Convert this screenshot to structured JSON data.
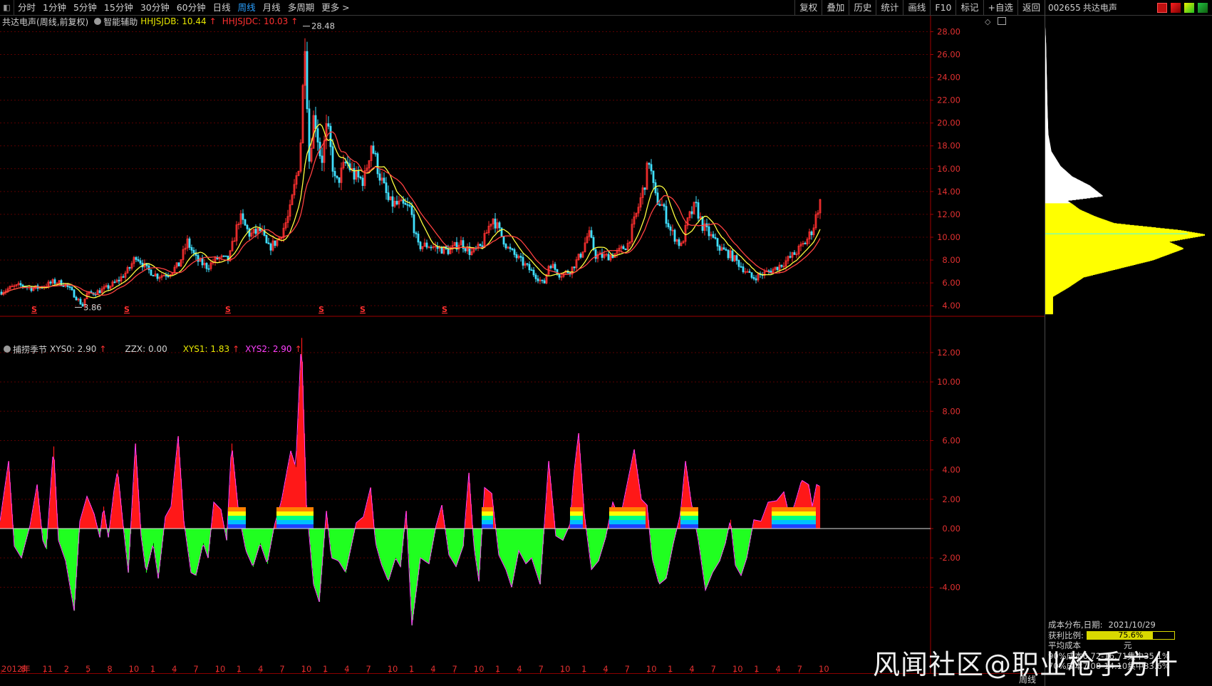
{
  "toolbar": {
    "period_tabs": [
      "分时",
      "1分钟",
      "5分钟",
      "15分钟",
      "30分钟",
      "60分钟",
      "日线",
      "周线",
      "月线",
      "多周期",
      "更多 >"
    ],
    "active_tab_index": 7,
    "right_buttons": [
      "复权",
      "叠加",
      "历史",
      "统计",
      "画线",
      "F10",
      "标记",
      "+自选",
      "返回"
    ]
  },
  "right_panel": {
    "code": "002655",
    "name": "共达电声",
    "cost_title": "成本分布,日期:",
    "cost_date": "2021/10/29",
    "profit_label": "获利比例:",
    "profit_pct": "75.6%",
    "profit_value": 75.6,
    "avg_cost_label": "平均成本",
    "avg_cost_unit": "元",
    "row90": "90%成本6.72-16.71集中35.1%",
    "row70": "70%成本7.08-14.10集中33.6%"
  },
  "price_panel": {
    "stock": "共达电声",
    "period_info": "(周线,前复权)",
    "assist_label": "智能辅助",
    "hh1_label": "HHJSJDB: 10.44",
    "hh2_label": "HHJSJDC: 10.03",
    "high_label": "28.48",
    "low_label": "3.86",
    "s_marker": "S"
  },
  "indicator_panel": {
    "name": "捕捞季节",
    "xys0": "XYS0: 2.90",
    "zzx": "ZZX: 0.00",
    "xys1": "XYS1: 1.83",
    "xys2": "XYS2: 2.90"
  },
  "x_axis": {
    "labels": [
      "2012年",
      "8",
      "11",
      "2",
      "5",
      "8",
      "10",
      "1",
      "4",
      "7",
      "10",
      "1",
      "4",
      "7",
      "10",
      "1",
      "4",
      "7",
      "10",
      "1",
      "4",
      "7",
      "10",
      "1",
      "4",
      "7",
      "10",
      "1",
      "4",
      "7",
      "10",
      "1",
      "4",
      "7",
      "10",
      "1",
      "4",
      "7",
      "10"
    ],
    "period": "周线"
  },
  "watermark": "风闻社区@职业枪手方什",
  "chart_data": [
    {
      "type": "candlestick",
      "title": "共达电声",
      "ylim": [
        3.2,
        29.4
      ],
      "yticks": [
        4,
        6,
        8,
        10,
        12,
        14,
        16,
        18,
        20,
        22,
        24,
        26,
        28
      ],
      "keypoints": [
        [
          0,
          5.2
        ],
        [
          15,
          5.6
        ],
        [
          30,
          5.8
        ],
        [
          45,
          5.5
        ],
        [
          60,
          5.7
        ],
        [
          75,
          6.1
        ],
        [
          90,
          5.9
        ],
        [
          100,
          5.2
        ],
        [
          110,
          4.4
        ],
        [
          115,
          4.0
        ],
        [
          120,
          5.0
        ],
        [
          135,
          5.2
        ],
        [
          150,
          5.6
        ],
        [
          165,
          6.2
        ],
        [
          180,
          7.2
        ],
        [
          190,
          8.4
        ],
        [
          205,
          7.2
        ],
        [
          220,
          6.6
        ],
        [
          235,
          6.8
        ],
        [
          250,
          7.6
        ],
        [
          262,
          9.6
        ],
        [
          275,
          8.0
        ],
        [
          290,
          7.4
        ],
        [
          305,
          8.2
        ],
        [
          320,
          8.0
        ],
        [
          335,
          11.8
        ],
        [
          350,
          10.2
        ],
        [
          365,
          10.6
        ],
        [
          375,
          9.0
        ],
        [
          390,
          9.8
        ],
        [
          405,
          12.0
        ],
        [
          420,
          17.0
        ],
        [
          427,
          27.5
        ],
        [
          433,
          16.8
        ],
        [
          440,
          21.0
        ],
        [
          450,
          16.5
        ],
        [
          458,
          19.8
        ],
        [
          470,
          14.5
        ],
        [
          485,
          16.6
        ],
        [
          498,
          15.2
        ],
        [
          510,
          15.0
        ],
        [
          520,
          18.2
        ],
        [
          532,
          15.4
        ],
        [
          545,
          13.0
        ],
        [
          560,
          12.8
        ],
        [
          575,
          12.5
        ],
        [
          585,
          9.2
        ],
        [
          600,
          9.3
        ],
        [
          615,
          9.0
        ],
        [
          630,
          8.8
        ],
        [
          645,
          9.6
        ],
        [
          660,
          8.6
        ],
        [
          675,
          9.2
        ],
        [
          690,
          11.8
        ],
        [
          700,
          10.5
        ],
        [
          712,
          9.0
        ],
        [
          725,
          8.2
        ],
        [
          740,
          7.3
        ],
        [
          755,
          6.4
        ],
        [
          762,
          5.8
        ],
        [
          770,
          7.8
        ],
        [
          785,
          6.7
        ],
        [
          800,
          7.1
        ],
        [
          815,
          8.6
        ],
        [
          825,
          10.4
        ],
        [
          835,
          8.4
        ],
        [
          850,
          8.3
        ],
        [
          865,
          8.6
        ],
        [
          880,
          9.4
        ],
        [
          893,
          12.2
        ],
        [
          903,
          14.5
        ],
        [
          910,
          16.8
        ],
        [
          918,
          13.5
        ],
        [
          928,
          12.8
        ],
        [
          940,
          10.6
        ],
        [
          955,
          9.2
        ],
        [
          965,
          11.6
        ],
        [
          975,
          12.8
        ],
        [
          985,
          11.0
        ],
        [
          995,
          10.2
        ],
        [
          1010,
          9.0
        ],
        [
          1025,
          8.4
        ],
        [
          1040,
          7.4
        ],
        [
          1055,
          6.4
        ],
        [
          1070,
          6.8
        ],
        [
          1085,
          7.2
        ],
        [
          1100,
          7.8
        ],
        [
          1115,
          8.6
        ],
        [
          1130,
          9.6
        ],
        [
          1140,
          10.8
        ],
        [
          1148,
          12.8
        ],
        [
          1150,
          13.0
        ]
      ]
    },
    {
      "type": "area",
      "title": "捕捞季节",
      "ylim": [
        -6.8,
        13.6
      ],
      "yticks": [
        -4,
        -2,
        0,
        2,
        4,
        6,
        8,
        10,
        12
      ],
      "keypoints": [
        [
          0,
          0.5
        ],
        [
          12,
          4.6
        ],
        [
          20,
          -1.2
        ],
        [
          30,
          -2.0
        ],
        [
          42,
          0.2
        ],
        [
          52,
          3.0
        ],
        [
          60,
          -0.8
        ],
        [
          65,
          -1.4
        ],
        [
          75,
          5.6
        ],
        [
          82,
          -0.8
        ],
        [
          92,
          -2.2
        ],
        [
          104,
          -5.6
        ],
        [
          112,
          0.5
        ],
        [
          122,
          2.2
        ],
        [
          132,
          1.0
        ],
        [
          140,
          -0.6
        ],
        [
          145,
          1.5
        ],
        [
          152,
          -0.6
        ],
        [
          160,
          2.6
        ],
        [
          165,
          4.0
        ],
        [
          172,
          0.6
        ],
        [
          180,
          -3.0
        ],
        [
          190,
          5.8
        ],
        [
          198,
          -0.5
        ],
        [
          205,
          -3.0
        ],
        [
          215,
          -1.0
        ],
        [
          222,
          -3.4
        ],
        [
          232,
          0.8
        ],
        [
          240,
          1.5
        ],
        [
          250,
          6.3
        ],
        [
          258,
          0.5
        ],
        [
          268,
          -3.0
        ],
        [
          275,
          -3.2
        ],
        [
          285,
          -1.0
        ],
        [
          292,
          -2.0
        ],
        [
          300,
          1.8
        ],
        [
          310,
          1.3
        ],
        [
          318,
          -0.8
        ],
        [
          325,
          5.8
        ],
        [
          335,
          1.0
        ],
        [
          345,
          -1.5
        ],
        [
          355,
          -2.6
        ],
        [
          365,
          -1.0
        ],
        [
          375,
          -2.4
        ],
        [
          385,
          0.2
        ],
        [
          395,
          1.9
        ],
        [
          408,
          5.3
        ],
        [
          415,
          4.2
        ],
        [
          423,
          13.0
        ],
        [
          430,
          1.6
        ],
        [
          440,
          -3.8
        ],
        [
          448,
          -5.0
        ],
        [
          458,
          1.2
        ],
        [
          465,
          -2.0
        ],
        [
          475,
          -2.2
        ],
        [
          485,
          -3.0
        ],
        [
          500,
          0.4
        ],
        [
          510,
          0.8
        ],
        [
          520,
          2.8
        ],
        [
          527,
          -1.0
        ],
        [
          535,
          -2.4
        ],
        [
          545,
          -3.6
        ],
        [
          555,
          -2.0
        ],
        [
          562,
          -2.6
        ],
        [
          570,
          1.2
        ],
        [
          578,
          -6.6
        ],
        [
          590,
          -2.0
        ],
        [
          602,
          -2.4
        ],
        [
          612,
          0.2
        ],
        [
          620,
          1.6
        ],
        [
          630,
          -1.8
        ],
        [
          640,
          -2.6
        ],
        [
          650,
          -1.2
        ],
        [
          658,
          3.8
        ],
        [
          665,
          -1.2
        ],
        [
          672,
          -3.6
        ],
        [
          680,
          2.8
        ],
        [
          690,
          2.4
        ],
        [
          700,
          -1.8
        ],
        [
          710,
          -2.8
        ],
        [
          718,
          -4.0
        ],
        [
          728,
          -1.5
        ],
        [
          738,
          -2.4
        ],
        [
          746,
          -2.0
        ],
        [
          758,
          -3.8
        ],
        [
          765,
          1.0
        ],
        [
          770,
          4.6
        ],
        [
          780,
          -0.5
        ],
        [
          790,
          -0.8
        ],
        [
          800,
          0.3
        ],
        [
          805,
          3.6
        ],
        [
          812,
          6.5
        ],
        [
          820,
          1.0
        ],
        [
          830,
          -2.8
        ],
        [
          840,
          -2.2
        ],
        [
          850,
          -0.6
        ],
        [
          860,
          1.8
        ],
        [
          870,
          0.6
        ],
        [
          880,
          3.0
        ],
        [
          890,
          5.4
        ],
        [
          900,
          2.0
        ],
        [
          908,
          1.6
        ],
        [
          915,
          -2.0
        ],
        [
          925,
          -3.8
        ],
        [
          935,
          -3.4
        ],
        [
          945,
          -1.0
        ],
        [
          955,
          1.0
        ],
        [
          962,
          4.6
        ],
        [
          970,
          1.8
        ],
        [
          980,
          -0.8
        ],
        [
          990,
          -4.2
        ],
        [
          1000,
          -3.0
        ],
        [
          1010,
          -2.2
        ],
        [
          1018,
          -1.0
        ],
        [
          1025,
          0.6
        ],
        [
          1032,
          -2.5
        ],
        [
          1040,
          -3.2
        ],
        [
          1048,
          -2.0
        ],
        [
          1058,
          0.6
        ],
        [
          1068,
          0.5
        ],
        [
          1078,
          1.8
        ],
        [
          1090,
          1.9
        ],
        [
          1100,
          2.5
        ],
        [
          1108,
          0.8
        ],
        [
          1115,
          1.6
        ],
        [
          1125,
          3.3
        ],
        [
          1135,
          3.0
        ],
        [
          1140,
          1.5
        ],
        [
          1146,
          3.0
        ],
        [
          1150,
          2.9
        ]
      ]
    },
    {
      "type": "histogram",
      "title": "成本分布",
      "keypoints": [
        [
          4.8,
          10
        ],
        [
          5.6,
          30
        ],
        [
          6.5,
          50
        ],
        [
          7.2,
          92
        ],
        [
          8.0,
          140
        ],
        [
          9.0,
          180
        ],
        [
          9.6,
          160
        ],
        [
          10.2,
          210
        ],
        [
          10.6,
          175
        ],
        [
          11.2,
          90
        ],
        [
          11.8,
          65
        ],
        [
          12.4,
          45
        ],
        [
          12.9,
          35
        ],
        [
          13.2,
          28
        ],
        [
          13.6,
          75
        ],
        [
          14.5,
          58
        ],
        [
          15.3,
          35
        ],
        [
          16.2,
          20
        ],
        [
          17.5,
          8
        ],
        [
          19.0,
          4
        ],
        [
          21.0,
          3
        ],
        [
          24.0,
          2
        ],
        [
          27.0,
          1
        ],
        [
          28.4,
          0
        ]
      ]
    }
  ]
}
